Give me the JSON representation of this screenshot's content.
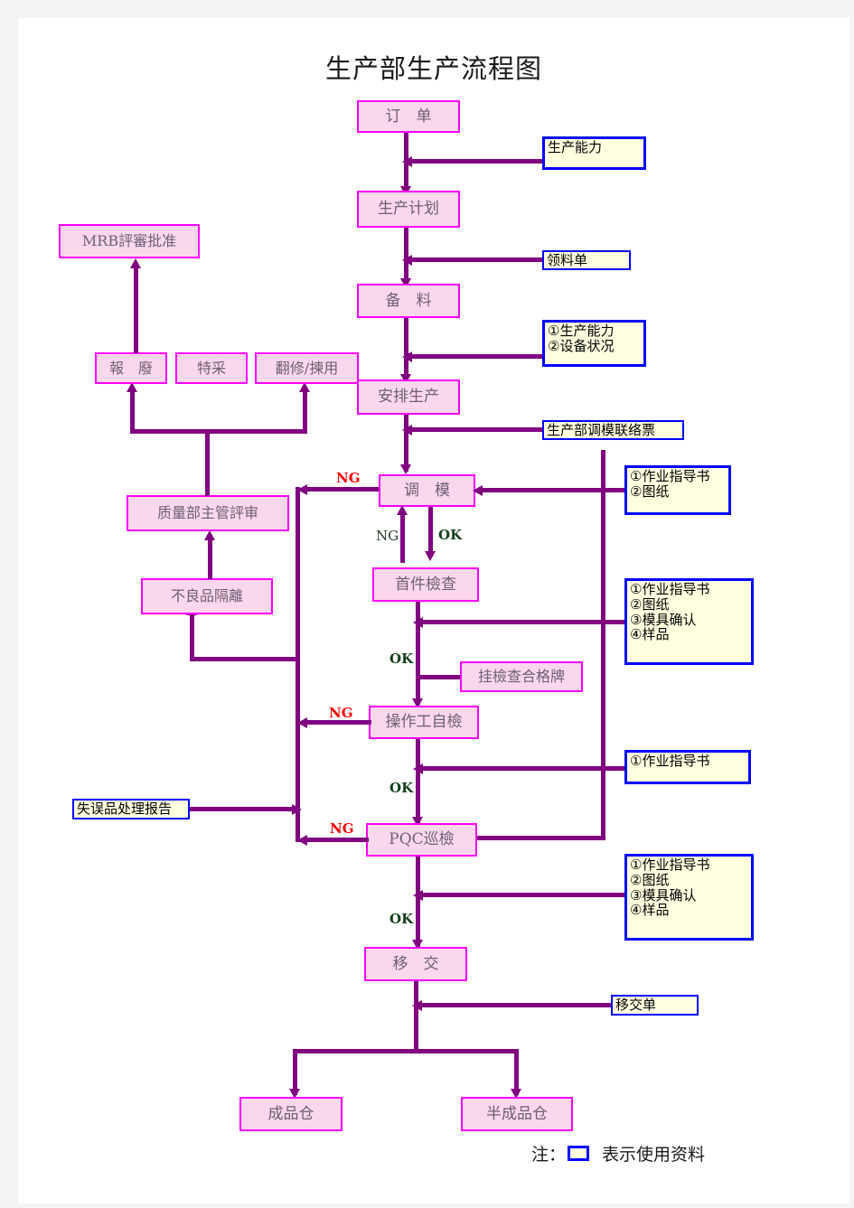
{
  "title": "生产部生产流程图",
  "legend": {
    "prefix": "注：",
    "swatch_name": "note-box-swatch",
    "text": "表示使用资料",
    "swatch_border_color": "#0000FF",
    "swatch_fill_color": "#FFFFE0"
  },
  "colors": {
    "process_fill": "#FBD7EC",
    "process_border": "#FF00FF",
    "note_fill": "#FFFFE0",
    "note_border": "#0000FF",
    "connector": "#800080",
    "ng_label": "#FF0000",
    "ok_label": "#13401C",
    "page_background": "#FFFFFF"
  },
  "process_boxes": {
    "order": "订　单",
    "production_plan": "生产计划",
    "prepare_material": "备　料",
    "arrange_production": "安排生产",
    "adjust_mold": "调　模",
    "first_article_inspection": "首件檢查",
    "hang_pass_tag": "挂檢查合格牌",
    "operator_self_check": "操作工自檢",
    "pqc_patrol": "PQC巡檢",
    "transfer": "移　交",
    "finished_goods_warehouse": "成品仓",
    "semi_finished_warehouse": "半成品仓",
    "mrb_review_approval": "MRB評審批准",
    "scrap": "報　廢",
    "special_accept": "特采",
    "rework_select": "翻修/揀用",
    "quality_supervisor_review": "质量部主管評审",
    "defect_isolation": "不良品隔離"
  },
  "note_boxes": {
    "capacity": "生产能力",
    "material_requisition": "领料单",
    "capacity_and_equipment": "①生产能力\n②设备状况",
    "mold_change_contact_sheet": "生产部调模联络票",
    "wi_and_drawing": "①作业指导书\n②图纸",
    "wi_drawing_mold_sample_a": "①作业指导书\n②图纸\n③模具确认\n④样品",
    "wi_only": "①作业指导书",
    "wi_drawing_mold_sample_b": "①作业指导书\n②图纸\n③模具确认\n④样品",
    "error_product_report": "失误品处理报告",
    "transfer_sheet": "移交单"
  },
  "edge_labels": {
    "ng_adjust_mold": "NG",
    "ng_under_mold": "NG",
    "ok_under_mold": "OK",
    "ok_first_article": "OK",
    "ng_operator": "NG",
    "ok_operator": "OK",
    "ng_pqc": "NG",
    "ok_pqc": "OK"
  }
}
